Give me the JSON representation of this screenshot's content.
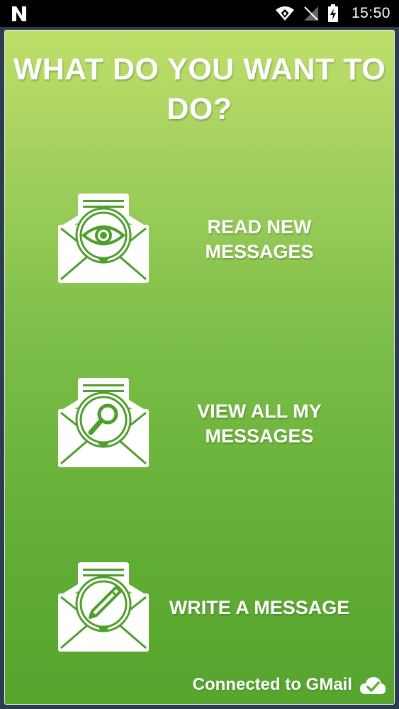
{
  "status_bar": {
    "time": "15:50",
    "icons": [
      "notification-n-icon",
      "wifi-icon",
      "no-signal-icon",
      "battery-charging-icon"
    ]
  },
  "main": {
    "title": "WHAT DO YOU WANT TO DO?",
    "options": [
      {
        "label": "READ NEW MESSAGES",
        "icon": "envelope-eye-icon"
      },
      {
        "label": "VIEW ALL MY MESSAGES",
        "icon": "envelope-search-icon"
      },
      {
        "label": "WRITE A MESSAGE",
        "icon": "envelope-pencil-icon"
      }
    ]
  },
  "footer": {
    "status_text": "Connected to GMail",
    "icon": "cloud-check-icon"
  },
  "colors": {
    "gradient_top": "#bfdf6a",
    "gradient_bottom": "#56a52e",
    "frame": "#2a3b52",
    "icon_stroke": "#4f9e2c"
  }
}
